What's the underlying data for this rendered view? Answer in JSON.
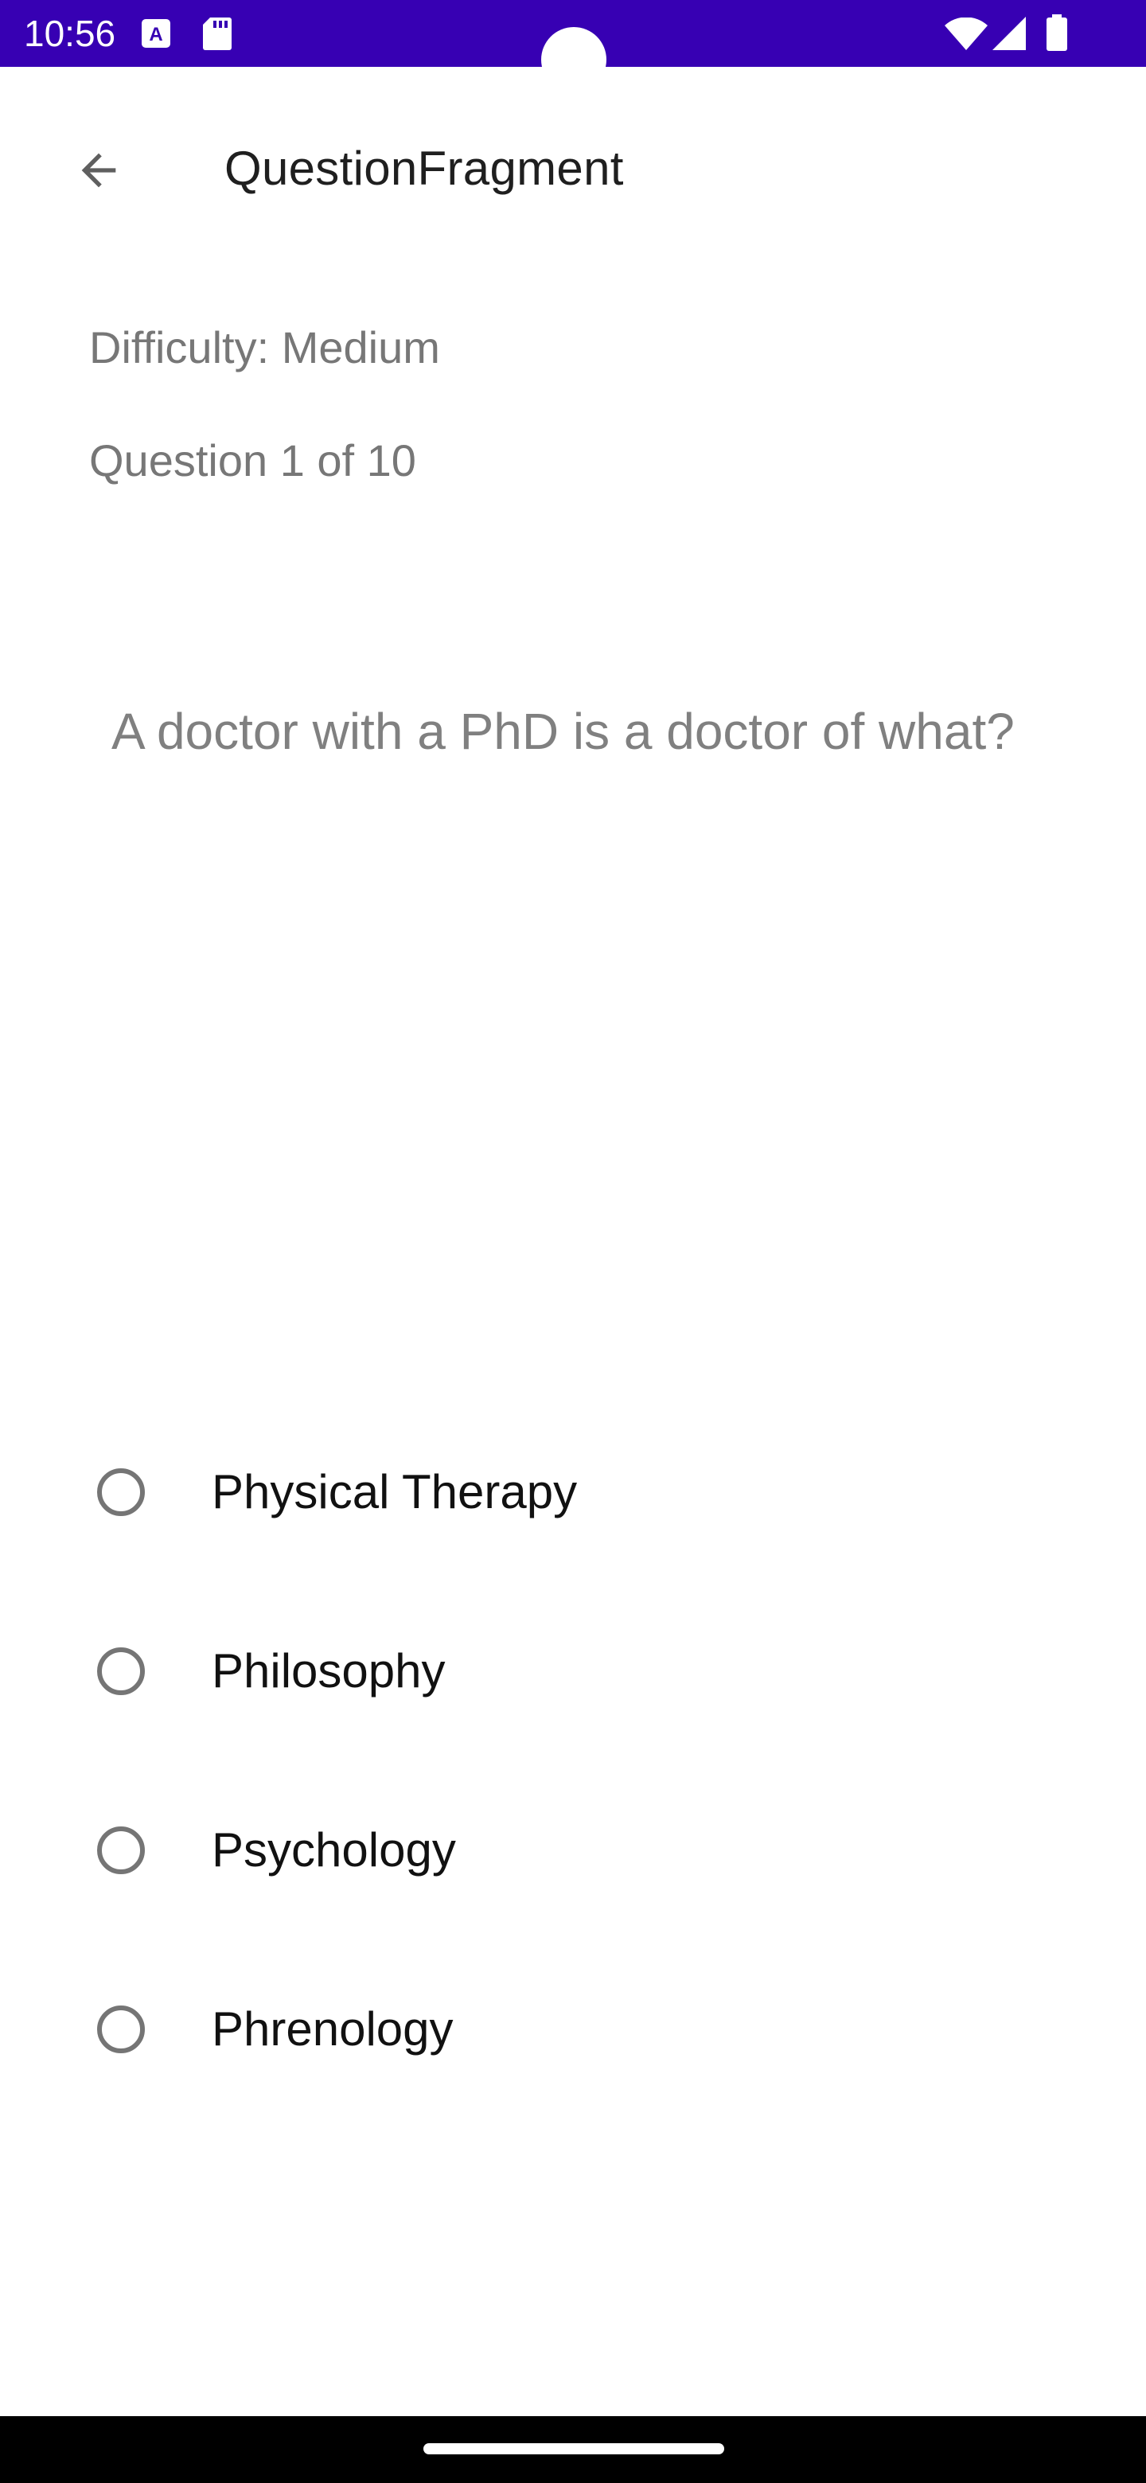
{
  "status_bar": {
    "time": "10:56",
    "background": "#3700b3",
    "icons": [
      "a-notification-icon",
      "sd-card-icon",
      "wifi-icon",
      "cellular-signal-icon",
      "battery-icon"
    ]
  },
  "toolbar": {
    "title": "QuestionFragment",
    "back_icon": "arrow-back-icon"
  },
  "quiz": {
    "difficulty": "Difficulty: Medium",
    "progress": "Question 1 of 10",
    "question": "A doctor with a PhD is a doctor of what?",
    "options": [
      {
        "label": "Physical Therapy",
        "selected": false
      },
      {
        "label": "Philosophy",
        "selected": false
      },
      {
        "label": "Psychology",
        "selected": false
      },
      {
        "label": "Phrenology",
        "selected": false
      }
    ]
  }
}
